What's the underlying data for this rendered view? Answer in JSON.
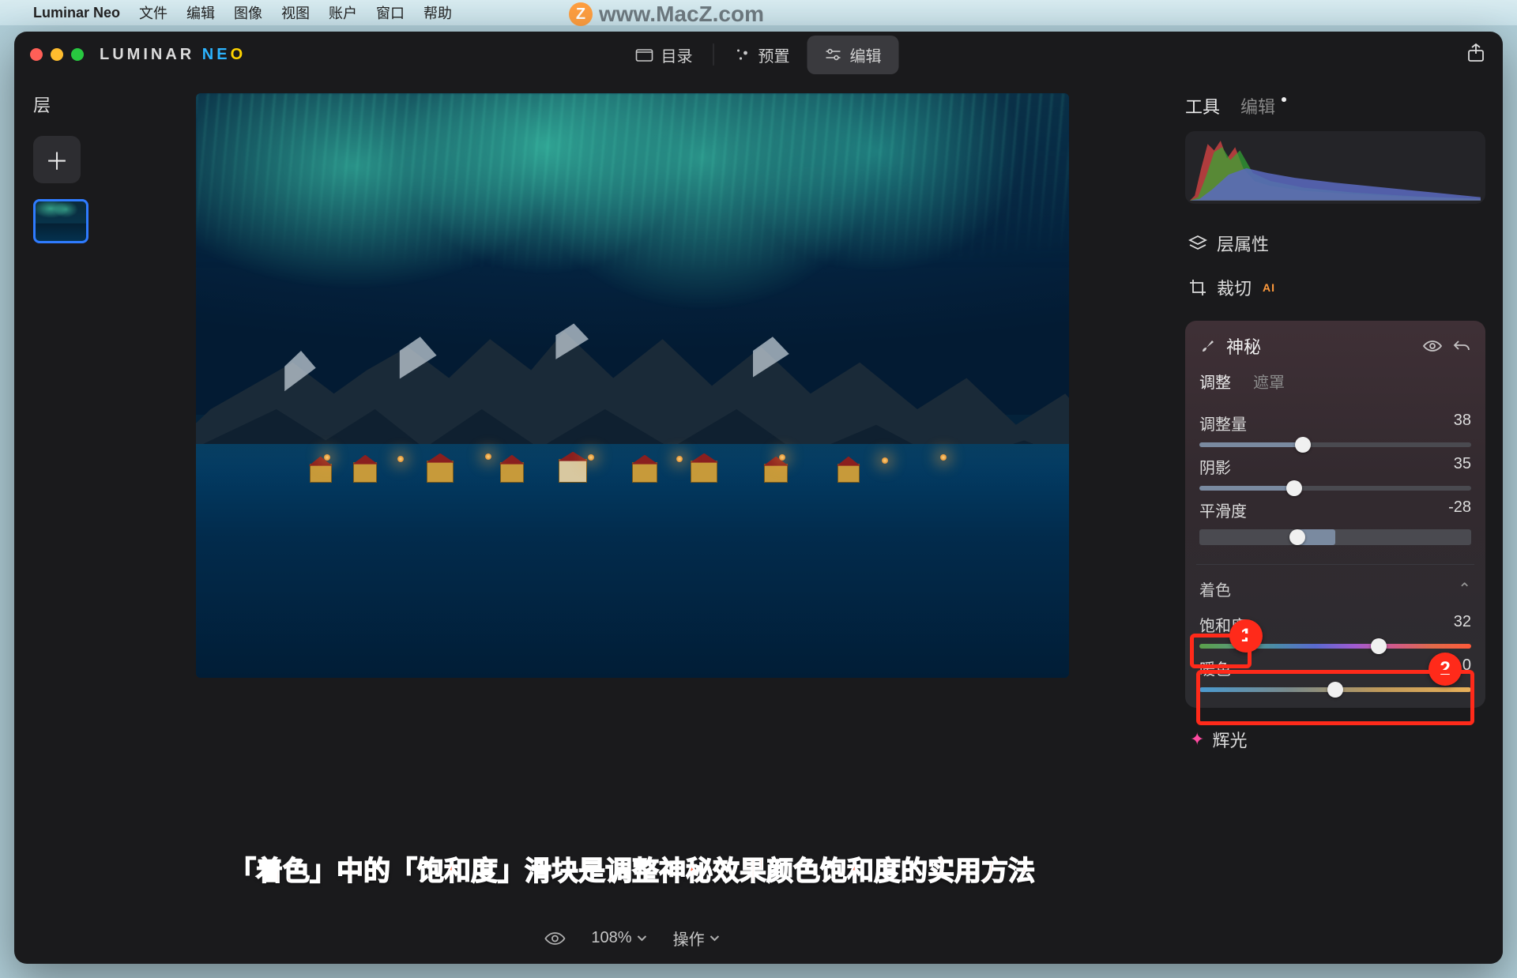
{
  "menubar": {
    "app": "Luminar Neo",
    "items": [
      "文件",
      "编辑",
      "图像",
      "视图",
      "账户",
      "窗口",
      "帮助"
    ]
  },
  "watermark": {
    "badge": "Z",
    "text": "www.MacZ.com"
  },
  "brand": {
    "pre": "LUMINAR ",
    "n": "N",
    "e": "E",
    "o": "O"
  },
  "centerTabs": {
    "catalog": "目录",
    "presets": "预置",
    "edit": "编辑"
  },
  "leftPanel": {
    "title": "层"
  },
  "bottomBar": {
    "zoom": "108%",
    "ops": "操作"
  },
  "caption": "「着色」中的「饱和度」滑块是调整神秘效果颜色饱和度的实用方法",
  "rightTabs": {
    "tools": "工具",
    "edit": "编辑"
  },
  "toolRows": {
    "layerProps": "层属性",
    "crop": "裁切",
    "cropAI": "AI"
  },
  "panel": {
    "title": "神秘",
    "tabs": {
      "adjust": "调整",
      "mask": "遮罩"
    },
    "sliders": {
      "amount": {
        "label": "调整量",
        "value": 38,
        "pos": 38
      },
      "shadow": {
        "label": "阴影",
        "value": 35,
        "pos": 35
      },
      "smooth": {
        "label": "平滑度",
        "value": -28,
        "pos": 36
      }
    },
    "tint": {
      "header": "着色",
      "chev": "⌃"
    },
    "tintSliders": {
      "sat": {
        "label": "饱和度",
        "value": 32,
        "pos": 66
      },
      "warm": {
        "label": "暖色",
        "value": 0,
        "pos": 50
      }
    }
  },
  "glow": "辉光",
  "badges": {
    "one": "1",
    "two": "2"
  }
}
